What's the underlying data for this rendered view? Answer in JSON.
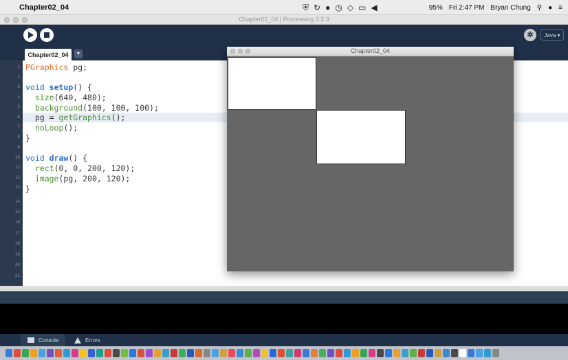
{
  "menubar": {
    "app_name": "Chapter02_04",
    "battery": "95%",
    "time": "Fri 2:47 PM",
    "user": "Bryan Chung"
  },
  "window": {
    "title": "Chapter02_04 | Processing 3.2.3"
  },
  "toolbar": {
    "mode": "Java ▾"
  },
  "tabs": [
    {
      "label": "Chapter02_04"
    }
  ],
  "editor": {
    "line_numbers": [
      "1",
      "2",
      "3",
      "4",
      "5",
      "6",
      "7",
      "8",
      "9",
      "10",
      "11",
      "12",
      "13",
      "14",
      "15",
      "16",
      "17",
      "18",
      "19",
      "20",
      "21"
    ],
    "highlighted_line": 6
  },
  "sketch": {
    "title": "Chapter02_04",
    "background": "#646464"
  },
  "console_tabs": [
    {
      "label": "Console"
    },
    {
      "label": "Errors"
    }
  ],
  "colors": {
    "toolbar": "#1f3048",
    "keyword": "#2a6dc9",
    "function": "#4d8c30",
    "type": "#e2661a"
  }
}
